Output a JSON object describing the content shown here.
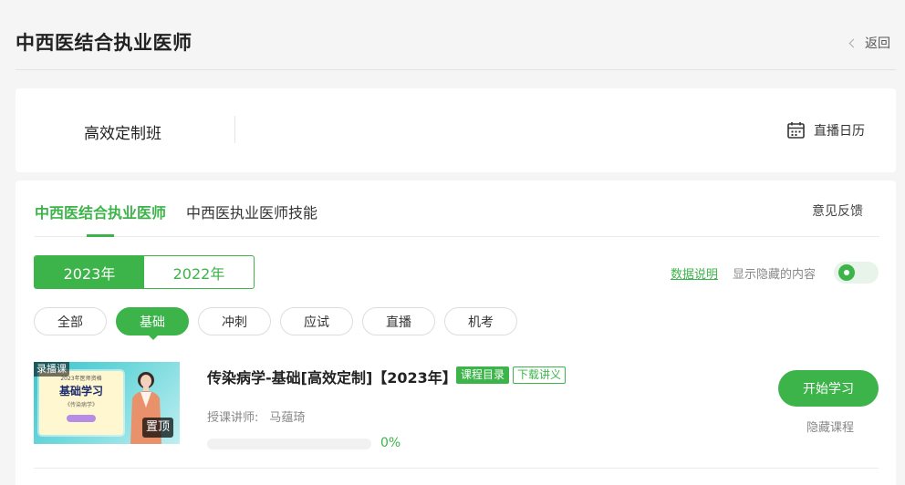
{
  "header": {
    "title": "中西医结合执业医师",
    "back_label": "返回"
  },
  "class_bar": {
    "class_name": "高效定制班",
    "calendar_label": "直播日历",
    "calendar_icon": "calendar-icon"
  },
  "tabs": {
    "items": [
      {
        "label": "中西医结合执业医师",
        "active": true
      },
      {
        "label": "中西医执业医师技能",
        "active": false
      }
    ],
    "feedback_label": "意见反馈"
  },
  "years": {
    "items": [
      {
        "label": "2023年",
        "active": true
      },
      {
        "label": "2022年",
        "active": false
      }
    ]
  },
  "options": {
    "data_explain_label": "数据说明",
    "show_hidden_label": "显示隐藏的内容",
    "show_hidden_on": false
  },
  "filters": {
    "items": [
      {
        "label": "全部",
        "active": false
      },
      {
        "label": "基础",
        "active": true
      },
      {
        "label": "冲刺",
        "active": false
      },
      {
        "label": "应试",
        "active": false
      },
      {
        "label": "直播",
        "active": false
      },
      {
        "label": "机考",
        "active": false
      }
    ]
  },
  "course": {
    "title": "传染病学-基础[高效定制]【2023年】",
    "tag_catalog": "课程目录",
    "tag_download": "下载讲义",
    "teacher_label": "授课讲师:",
    "teacher_name": "马蕴琦",
    "progress": 0,
    "progress_text": "0%",
    "start_label": "开始学习",
    "hide_label": "隐藏课程",
    "thumb": {
      "record_badge": "录播课",
      "pin_badge": "置顶",
      "subtitle": "2023年医师资格",
      "big_text": "基础学习",
      "small_text": "《传染病学》"
    }
  },
  "colors": {
    "accent": "#3db44a",
    "background": "#f5f5f5",
    "card": "#ffffff",
    "muted_text": "#888888"
  }
}
